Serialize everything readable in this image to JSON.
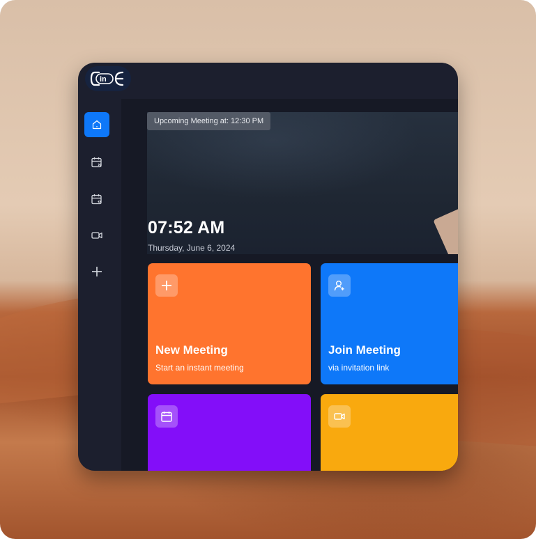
{
  "colors": {
    "sidebar_bg": "#1c1f2e",
    "main_bg": "#161925",
    "active_nav": "#0e78f9",
    "new_meeting": "#ff742e",
    "join_meeting": "#0e78f9",
    "schedule_meeting": "#830ef9",
    "view_recordings": "#f9a90e"
  },
  "logo": {
    "text": "in",
    "icon": "logo-mark"
  },
  "sidebar": {
    "items": [
      {
        "name": "home",
        "icon": "home-icon",
        "active": true
      },
      {
        "name": "upcoming",
        "icon": "calendar-forward-icon",
        "active": false
      },
      {
        "name": "previous",
        "icon": "calendar-back-icon",
        "active": false
      },
      {
        "name": "recordings",
        "icon": "video-icon",
        "active": false
      },
      {
        "name": "personal-room",
        "icon": "plus-icon",
        "active": false
      }
    ]
  },
  "hero": {
    "upcoming_label": "Upcoming Meeting at: 12:30 PM",
    "time": "07:52 AM",
    "date": "Thursday, June 6, 2024"
  },
  "cards": [
    {
      "title": "New Meeting",
      "subtitle": "Start an instant meeting",
      "icon": "plus-icon"
    },
    {
      "title": "Join Meeting",
      "subtitle": "via invitation link",
      "icon": "user-add-icon"
    },
    {
      "title": "",
      "subtitle": "",
      "icon": "calendar-icon"
    },
    {
      "title": "",
      "subtitle": "",
      "icon": "video-icon"
    }
  ]
}
